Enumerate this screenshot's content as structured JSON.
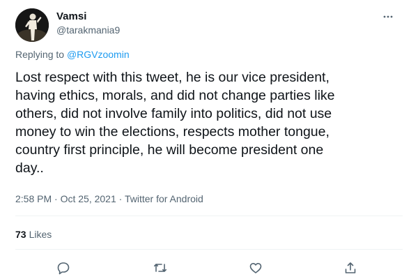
{
  "author": {
    "display_name": "Vamsi",
    "handle": "@tarakmania9"
  },
  "reply_context": {
    "prefix": "Replying to",
    "mention": "@RGVzoomin"
  },
  "tweet": {
    "text_lines": [
      "Lost respect with this tweet, he is our vice president,",
      "having ethics, morals, and did not change parties like",
      "others, did not involve family into politics, did not use",
      "money to win the elections, respects mother tongue,",
      "country first principle, he will become president one",
      "day.."
    ],
    "time": "2:58 PM",
    "separator": "·",
    "date": "Oct 25, 2021",
    "source": "Twitter for Android"
  },
  "engagement": {
    "likes_count": "73",
    "likes_label": "Likes"
  },
  "actions": {
    "icons": [
      "reply-icon",
      "retweet-icon",
      "like-icon",
      "share-icon"
    ]
  },
  "colors": {
    "text": "#0f1419",
    "secondary": "#536471",
    "accent": "#1d9bf0",
    "divider": "#eff3f4"
  }
}
